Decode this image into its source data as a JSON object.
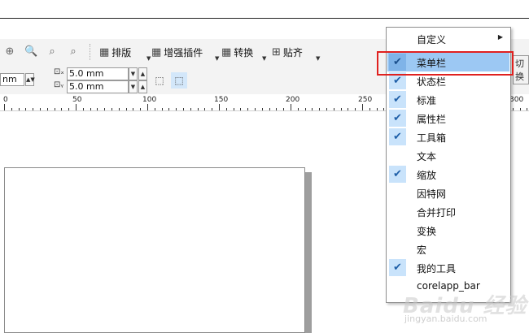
{
  "toolbar": {
    "buttons": [
      {
        "id": "layout",
        "label": "排版"
      },
      {
        "id": "enhance",
        "label": "增强插件"
      },
      {
        "id": "convert",
        "label": "转换"
      },
      {
        "id": "snap",
        "label": "贴齐"
      }
    ]
  },
  "property_bar": {
    "unit_fragment": "nm",
    "nudge_x": "5.0 mm",
    "nudge_y": "5.0 mm"
  },
  "ruler": {
    "labels": [
      "0",
      "50",
      "100",
      "150",
      "200",
      "250",
      "300"
    ]
  },
  "switch_label": "切换",
  "context_menu": {
    "customize": "自定义",
    "items": [
      {
        "label": "菜单栏",
        "checked": true,
        "highlighted": true
      },
      {
        "label": "状态栏",
        "checked": true
      },
      {
        "label": "标准",
        "checked": true
      },
      {
        "label": "属性栏",
        "checked": true
      },
      {
        "label": "工具箱",
        "checked": true
      },
      {
        "label": "文本",
        "checked": false
      },
      {
        "label": "缩放",
        "checked": true
      },
      {
        "label": "因特网",
        "checked": false
      },
      {
        "label": "合并打印",
        "checked": false
      },
      {
        "label": "变换",
        "checked": false
      },
      {
        "label": "宏",
        "checked": false
      },
      {
        "label": "我的工具",
        "checked": true
      },
      {
        "label": "corelapp_bar",
        "checked": false
      }
    ]
  },
  "watermark": {
    "text": "Baidu 经验",
    "url": "jingyan.baidu.com"
  },
  "colors": {
    "menu_highlight": "#9cc8f3",
    "check_bg": "#c9e3fb",
    "annotation_red": "#e0211f"
  }
}
